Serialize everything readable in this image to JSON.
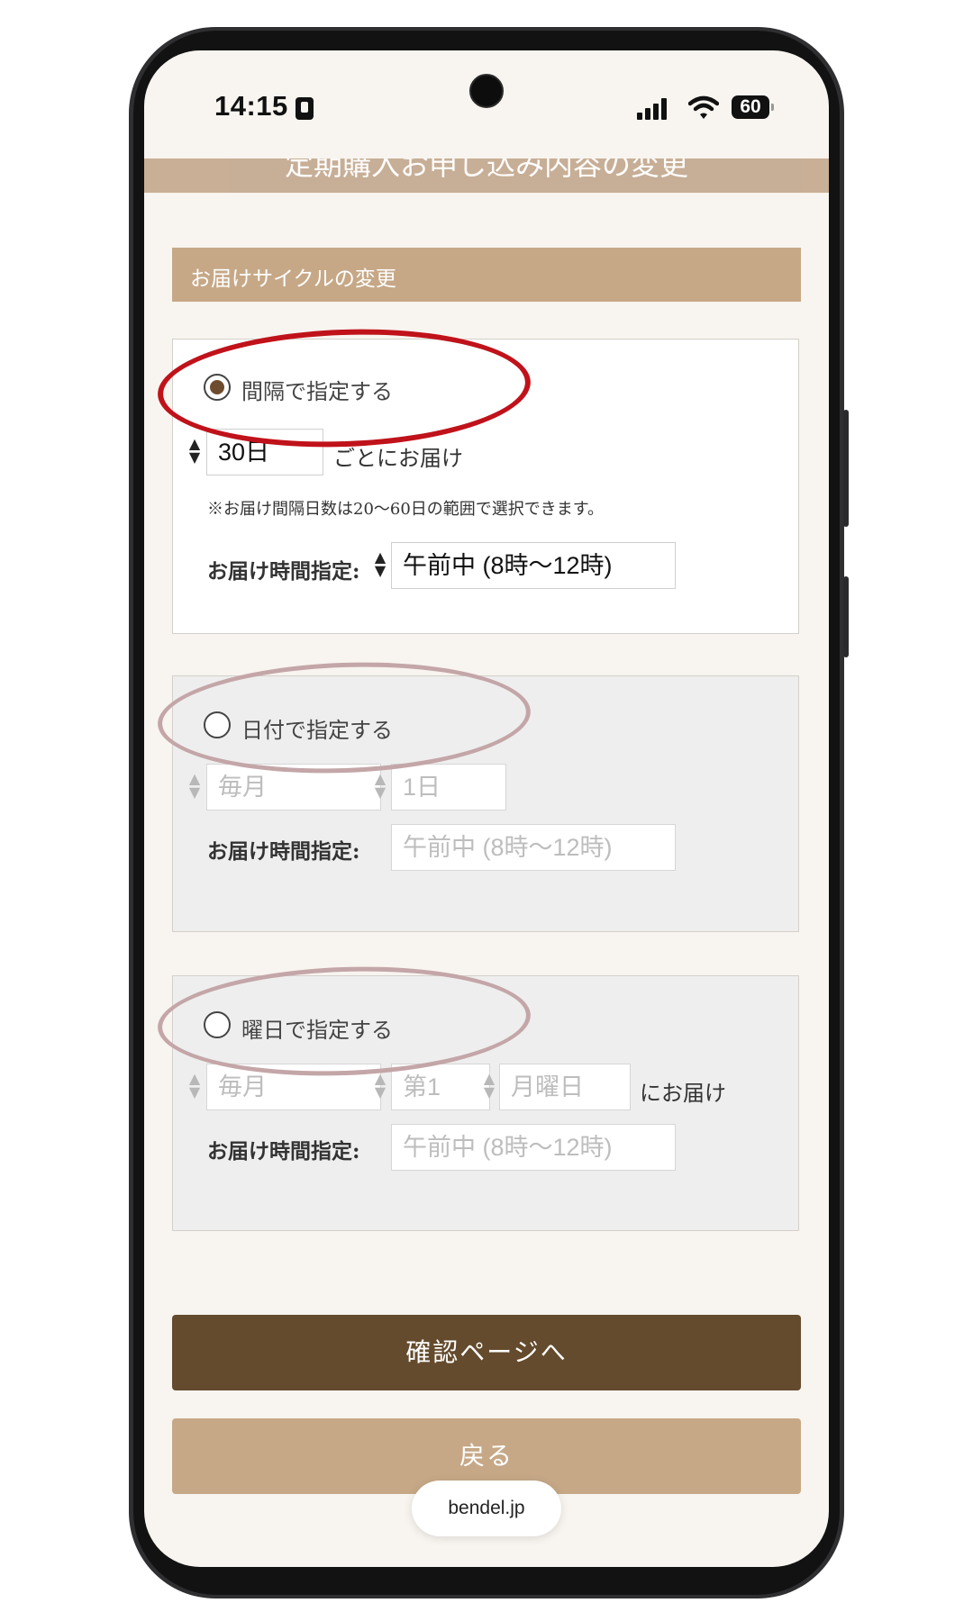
{
  "status_bar": {
    "time": "14:15",
    "battery": "60"
  },
  "page": {
    "header_title": "定期購入お申し込み内容の変更"
  },
  "section": {
    "title": "お届けサイクルの変更"
  },
  "option_interval": {
    "label": "間隔で指定する",
    "interval_value": "30日",
    "suffix": "ごとにお届け",
    "note": "※お届け間隔日数は20〜60日の範囲で選択できます。",
    "time_label": "お届け時間指定:",
    "time_value": "午前中 (8時〜12時)",
    "selected": true
  },
  "option_date": {
    "label": "日付で指定する",
    "month_value": "毎月",
    "day_value": "1日",
    "time_label": "お届け時間指定:",
    "time_value": "午前中 (8時〜12時)",
    "selected": false
  },
  "option_weekday": {
    "label": "曜日で指定する",
    "month_value": "毎月",
    "week_value": "第1",
    "weekday_value": "月曜日",
    "suffix": "にお届け",
    "time_label": "お届け時間指定:",
    "time_value": "午前中 (8時〜12時)",
    "selected": false
  },
  "buttons": {
    "confirm": "確認ページへ",
    "back": "戻る"
  },
  "browser": {
    "url": "bendel.jp"
  },
  "colors": {
    "brand_dark": "#644b2d",
    "brand_light": "#c6a887",
    "annotation_primary": "#c0121a",
    "annotation_muted": "#c4a6a8"
  },
  "icons": [
    "sim-icon",
    "signal-icon",
    "wifi-icon",
    "battery-icon",
    "radio-icon",
    "chevron-updown-icon"
  ]
}
